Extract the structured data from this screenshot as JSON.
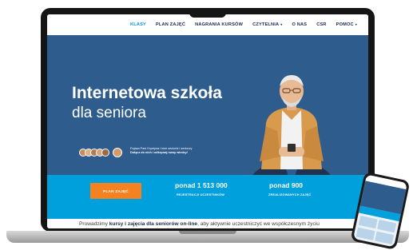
{
  "nav": {
    "items": [
      {
        "label": "KLASY",
        "active": true
      },
      {
        "label": "PLAN ZAJĘĆ",
        "active": false
      },
      {
        "label": "NAGRANIA KURSÓW",
        "active": false
      },
      {
        "label": "CZYTELNIA",
        "active": false,
        "dropdown": true
      },
      {
        "label": "O NAS",
        "active": false
      },
      {
        "label": "CSR",
        "active": false
      },
      {
        "label": "POMOC",
        "active": false,
        "dropdown": true
      }
    ]
  },
  "hero": {
    "title": "Internetowa szkoła",
    "subtitle": "dla seniora",
    "social_proof_line1": "Pojaza Pani Krystyna i inne seniorki i seniorzy",
    "social_proof_line2": "Dołącz do nich i odkrywaj nowy wiedzy!"
  },
  "stats": {
    "cta_label": "PLAN ZAJĘĆ",
    "items": [
      {
        "value": "ponad 1 513 000",
        "label": "REJESTRACJI UCZESTNIKÓW"
      },
      {
        "value": "ponad 900",
        "label": "ZREALIZOWANYCH ZAJĘĆ"
      }
    ]
  },
  "intro": {
    "prefix": "Prowadzimy ",
    "bold": "kursy i zajęcia dla seniorów on-line",
    "suffix": ", aby aktywnie uczestniczyć we współczesnym życiu"
  },
  "colors": {
    "hero_bg": "#2d5c8d",
    "stats_bg": "#00a0dd",
    "cta_bg": "#f58220",
    "nav_active": "#0096d8"
  }
}
